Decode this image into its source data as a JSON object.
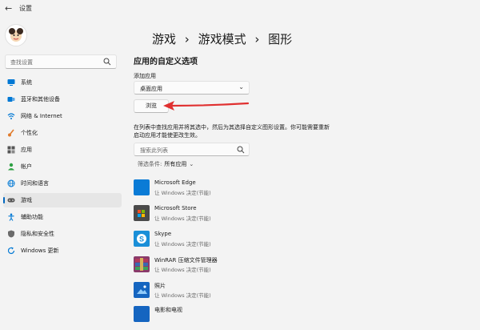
{
  "window": {
    "title": "设置"
  },
  "search": {
    "placeholder": "查找设置"
  },
  "sidebar": {
    "items": [
      {
        "label": "系统",
        "icon": "system-icon",
        "color": "#0078d4"
      },
      {
        "label": "蓝牙和其他设备",
        "icon": "bluetooth-icon",
        "color": "#0078d4"
      },
      {
        "label": "网络 & Internet",
        "icon": "network-icon",
        "color": "#0078d4"
      },
      {
        "label": "个性化",
        "icon": "brush-icon",
        "color": "#e07a2a"
      },
      {
        "label": "应用",
        "icon": "apps-icon",
        "color": "#555555"
      },
      {
        "label": "帐户",
        "icon": "account-icon",
        "color": "#2ea043"
      },
      {
        "label": "时间和语言",
        "icon": "globe-icon",
        "color": "#0078d4"
      },
      {
        "label": "游戏",
        "icon": "gamepad-icon",
        "color": "#555555",
        "active": true
      },
      {
        "label": "辅助功能",
        "icon": "accessibility-icon",
        "color": "#0078d4"
      },
      {
        "label": "隐私和安全性",
        "icon": "shield-icon",
        "color": "#6b6b6b"
      },
      {
        "label": "Windows 更新",
        "icon": "update-icon",
        "color": "#0078d4"
      }
    ]
  },
  "breadcrumb": {
    "part1": "游戏",
    "part2": "游戏模式",
    "part3": "图形",
    "separator": "›"
  },
  "main": {
    "section_title": "应用的自定义选项",
    "add_app_label": "添加应用",
    "dropdown_value": "桌面应用",
    "browse_label": "浏览",
    "description": "在列表中查找应用并将其选中，然后为其选择自定义图形设置。你可能需要重新启动应用才能使更改生效。",
    "list_search_placeholder": "搜索此列表",
    "filter_label": "筛选条件:",
    "filter_value": "所有应用",
    "accent_color": "#0067c0",
    "arrow_color": "#e03030"
  },
  "apps": [
    {
      "name": "Microsoft Edge",
      "sub": "让 Windows 决定(节能)",
      "icon": "edge-icon",
      "color": "#0a7bd6"
    },
    {
      "name": "Microsoft Store",
      "sub": "让 Windows 决定(节能)",
      "icon": "store-icon",
      "color": "#4a4a4a"
    },
    {
      "name": "Skype",
      "sub": "让 Windows 决定(节能)",
      "icon": "skype-icon",
      "color": "#1a8fd8"
    },
    {
      "name": "WinRAR 压缩文件管理器",
      "sub": "让 Windows 决定(节能)",
      "icon": "winrar-icon",
      "color": "#8a3a6a"
    },
    {
      "name": "照片",
      "sub": "让 Windows 决定(节能)",
      "icon": "photos-icon",
      "color": "#1565c0"
    },
    {
      "name": "电影和电视",
      "sub": "",
      "icon": "movies-icon",
      "color": "#1565c0"
    }
  ]
}
